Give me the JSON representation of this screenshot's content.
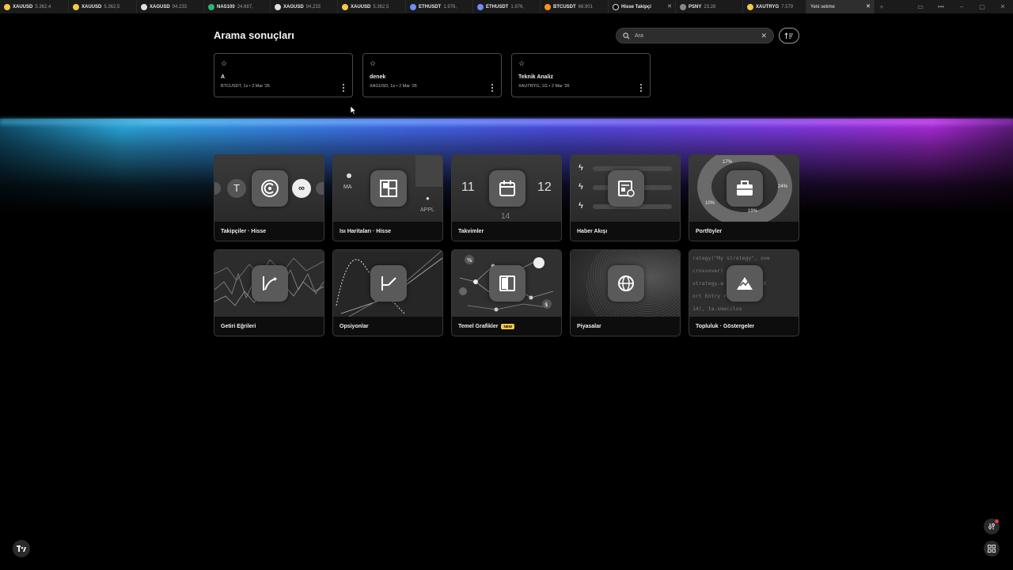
{
  "tabs": [
    {
      "symbol": "XAUUSD",
      "price": "5.362,4",
      "color": "#f2c94c"
    },
    {
      "symbol": "XAUUSD",
      "price": "5.362,5",
      "color": "#f2c94c"
    },
    {
      "symbol": "XAGUSD",
      "price": "94,233",
      "color": "#e0e0e0"
    },
    {
      "symbol": "NAS100",
      "price": "24.687,",
      "color": "#2bb673"
    },
    {
      "symbol": "XAGUSD",
      "price": "94,233",
      "color": "#e0e0e0"
    },
    {
      "symbol": "XAUUSD",
      "price": "5.362,5",
      "color": "#f2c94c"
    },
    {
      "symbol": "ETHUSDT",
      "price": "1.976,",
      "color": "#6c8ef5"
    },
    {
      "symbol": "ETHUSDT",
      "price": "1.976,",
      "color": "#6c8ef5"
    },
    {
      "symbol": "BTCUSDT",
      "price": "66.901",
      "color": "#f7931a"
    },
    {
      "symbol": "Hisse Takipçi",
      "price": "",
      "color": "#bdbdbd"
    },
    {
      "symbol": "PSNY",
      "price": "23,28",
      "color": "#888888"
    },
    {
      "symbol": "XAUTRYG",
      "price": "7.579",
      "color": "#f2c94c"
    },
    {
      "symbol": "Yeni sekme",
      "price": "",
      "color": ""
    }
  ],
  "header": {
    "title": "Arama sonuçları",
    "search_placeholder": "Ara"
  },
  "saved_layouts": [
    {
      "name": "A",
      "meta": "BTCUSDT, 1s • 2 Mar '26"
    },
    {
      "name": "denek",
      "meta": "XAGUSD, 1s • 2 Mar '26"
    },
    {
      "name": "Teknik Analiz",
      "meta": "XAUTRYG, 1G • 2 Mar '26"
    }
  ],
  "features": [
    {
      "label": "Takipçiler · Hisse",
      "icon": "radar-icon"
    },
    {
      "label": "Isı Haritaları · Hisse",
      "icon": "heatmap-icon"
    },
    {
      "label": "Takvimler",
      "icon": "calendar-icon"
    },
    {
      "label": "Haber Akışı",
      "icon": "news-icon"
    },
    {
      "label": "Portföyler",
      "icon": "briefcase-icon"
    },
    {
      "label": "Getiri Eğrileri",
      "icon": "yield-curve-icon"
    },
    {
      "label": "Opsiyonlar",
      "icon": "options-icon"
    },
    {
      "label": "Temel Grafikler",
      "icon": "fundamentals-icon",
      "badge": "NEW"
    },
    {
      "label": "Piyasalar",
      "icon": "globe-icon"
    },
    {
      "label": "Topluluk · Göstergeler",
      "icon": "community-icon"
    }
  ],
  "art_text": {
    "ma": "MA",
    "appl": "APPL",
    "cal_left": "11",
    "cal_right": "12",
    "cal_bottom": "14",
    "pct_17": "17%",
    "pct_24": "24%",
    "pct_10": "10%",
    "pct_19": "19%",
    "code_1": "rategy(\"My strategy\", ove",
    "code_2": "crossover(       close, ",
    "code_3": "strategy.e      tegy.long Ent",
    "code_4": "ort Entry       rategy.sho",
    "code_5": "    14), ta.sma(clos"
  }
}
